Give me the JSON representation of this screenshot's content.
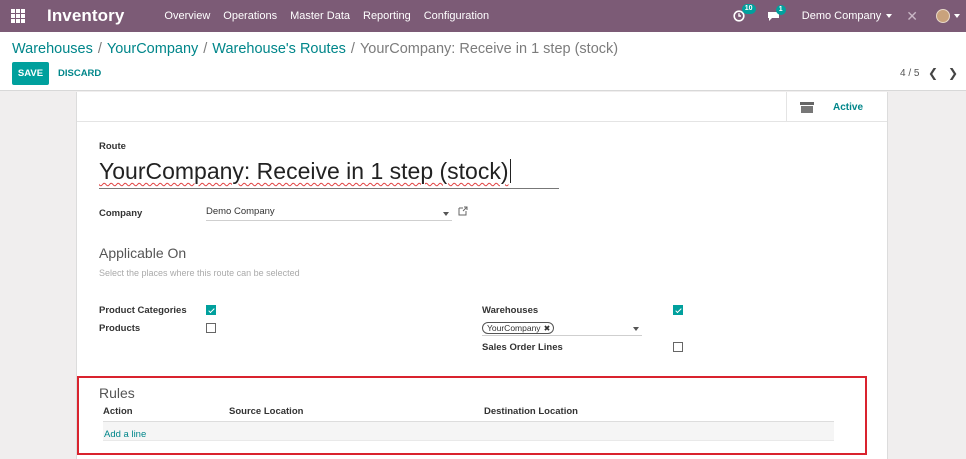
{
  "navbar": {
    "app_name": "Inventory",
    "menu": [
      "Overview",
      "Operations",
      "Master Data",
      "Reporting",
      "Configuration"
    ],
    "activity_count": "10",
    "message_count": "1",
    "company": "Demo Company"
  },
  "breadcrumb": {
    "items": [
      "Warehouses",
      "YourCompany",
      "Warehouse's Routes"
    ],
    "current": "YourCompany: Receive in 1 step (stock)"
  },
  "buttons": {
    "save": "SAVE",
    "discard": "DISCARD"
  },
  "pager": {
    "value": "4 / 5"
  },
  "status_button": {
    "label": "Active"
  },
  "form": {
    "route_label": "Route",
    "route_name": "YourCompany: Receive in 1 step (stock)",
    "company_label": "Company",
    "company_value": "Demo Company",
    "applicable_title": "Applicable On",
    "applicable_help": "Select the places where this route can be selected",
    "product_categories_label": "Product Categories",
    "product_categories_checked": true,
    "products_label": "Products",
    "products_checked": false,
    "warehouses_label": "Warehouses",
    "warehouses_checked": true,
    "warehouse_tag": "YourCompany",
    "sales_order_lines_label": "Sales Order Lines",
    "sales_order_lines_checked": false
  },
  "rules": {
    "title": "Rules",
    "columns": [
      "Action",
      "Source Location",
      "Destination Location"
    ],
    "add_line": "Add a line"
  },
  "colors": {
    "navbar": "#7c5b76",
    "primary": "#00a09d",
    "link": "#00868a",
    "highlight": "#d9232e"
  }
}
